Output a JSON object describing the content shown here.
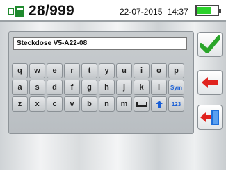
{
  "status_bar": {
    "counter": "28/999",
    "date": "22-07-2015",
    "time": "14:37",
    "battery_level": 0.7,
    "battery_color": "#2bd12b"
  },
  "editor": {
    "text_value": "Steckdose V5-A22-08"
  },
  "keyboard": {
    "row1": [
      "q",
      "w",
      "e",
      "r",
      "t",
      "y",
      "u",
      "i",
      "o",
      "p"
    ],
    "row2": [
      "a",
      "s",
      "d",
      "f",
      "g",
      "h",
      "j",
      "k",
      "l",
      "Sym"
    ],
    "row3": [
      "z",
      "x",
      "c",
      "v",
      "b",
      "n",
      "m"
    ],
    "numeric_label": "123"
  },
  "side_buttons": {
    "confirm_icon": "checkmark-icon",
    "back_icon": "left-arrow-icon",
    "exit_icon": "exit-door-icon"
  }
}
